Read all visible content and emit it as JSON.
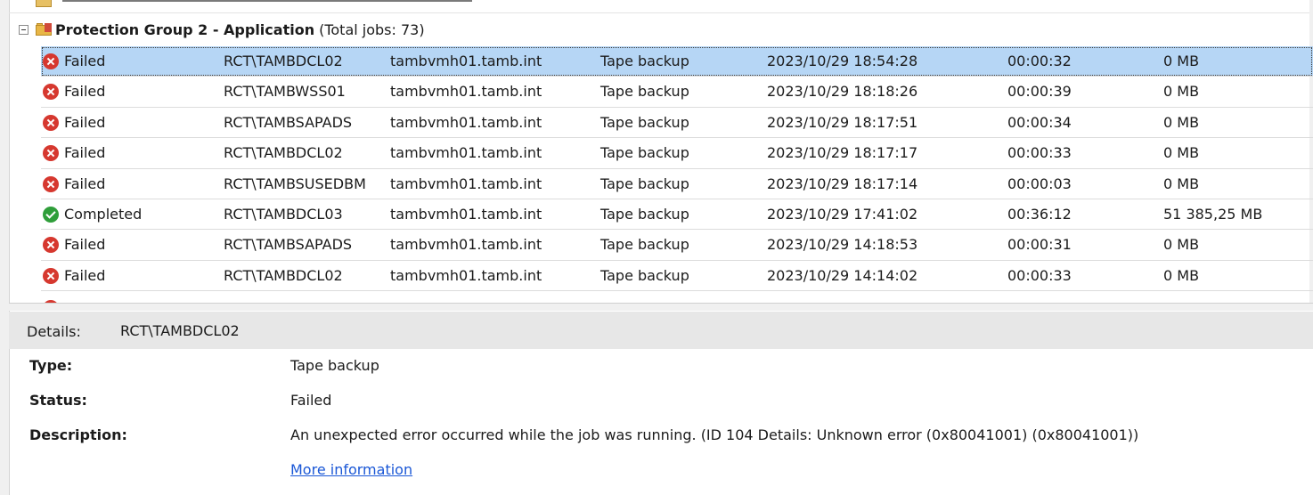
{
  "group": {
    "name": "Protection Group 2 - Application",
    "count_text": "(Total jobs: 73)"
  },
  "jobs": [
    {
      "status": "Failed",
      "status_kind": "failed",
      "name": "RCT\\TAMBDCL02",
      "server": "tambvmh01.tamb.int",
      "type": "Tape backup",
      "time": "2023/10/29 18:54:28",
      "duration": "00:00:32",
      "size": "0 MB",
      "selected": true
    },
    {
      "status": "Failed",
      "status_kind": "failed",
      "name": "RCT\\TAMBWSS01",
      "server": "tambvmh01.tamb.int",
      "type": "Tape backup",
      "time": "2023/10/29 18:18:26",
      "duration": "00:00:39",
      "size": "0 MB"
    },
    {
      "status": "Failed",
      "status_kind": "failed",
      "name": "RCT\\TAMBSAPADS",
      "server": "tambvmh01.tamb.int",
      "type": "Tape backup",
      "time": "2023/10/29 18:17:51",
      "duration": "00:00:34",
      "size": "0 MB"
    },
    {
      "status": "Failed",
      "status_kind": "failed",
      "name": "RCT\\TAMBDCL02",
      "server": "tambvmh01.tamb.int",
      "type": "Tape backup",
      "time": "2023/10/29 18:17:17",
      "duration": "00:00:33",
      "size": "0 MB"
    },
    {
      "status": "Failed",
      "status_kind": "failed",
      "name": "RCT\\TAMBSUSEDBM",
      "server": "tambvmh01.tamb.int",
      "type": "Tape backup",
      "time": "2023/10/29 18:17:14",
      "duration": "00:00:03",
      "size": "0 MB"
    },
    {
      "status": "Completed",
      "status_kind": "completed",
      "name": "RCT\\TAMBDCL03",
      "server": "tambvmh01.tamb.int",
      "type": "Tape backup",
      "time": "2023/10/29 17:41:02",
      "duration": "00:36:12",
      "size": "51 385,25 MB"
    },
    {
      "status": "Failed",
      "status_kind": "failed",
      "name": "RCT\\TAMBSAPADS",
      "server": "tambvmh01.tamb.int",
      "type": "Tape backup",
      "time": "2023/10/29 14:18:53",
      "duration": "00:00:31",
      "size": "0 MB"
    },
    {
      "status": "Failed",
      "status_kind": "failed",
      "name": "RCT\\TAMBDCL02",
      "server": "tambvmh01.tamb.int",
      "type": "Tape backup",
      "time": "2023/10/29 14:14:02",
      "duration": "00:00:33",
      "size": "0 MB"
    }
  ],
  "details": {
    "header_label": "Details:",
    "header_value": "RCT\\TAMBDCL02",
    "type_label": "Type:",
    "type_value": "Tape backup",
    "status_label": "Status:",
    "status_value": "Failed",
    "description_label": "Description:",
    "description_value": "An unexpected error occurred while the job was running. (ID 104 Details: Unknown error (0x80041001) (0x80041001))",
    "more_info_link": "More information"
  },
  "colors": {
    "selected_row": "#b6d6f5",
    "failed": "#d6382f",
    "completed": "#2f9e3a",
    "link": "#1a57d6",
    "details_header_bg": "#e7e7e7"
  }
}
